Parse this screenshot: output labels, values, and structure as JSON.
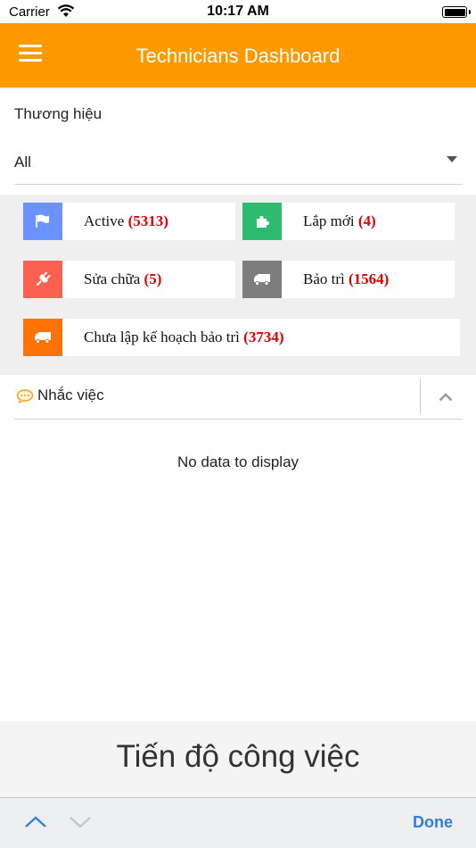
{
  "status_bar": {
    "carrier": "Carrier",
    "time": "10:17 AM",
    "battery_level": 1.0
  },
  "nav": {
    "title": "Technicians Dashboard",
    "menu_icon": "hamburger-menu-icon"
  },
  "filter": {
    "label": "Thương hiệu",
    "value": "All"
  },
  "tiles": [
    {
      "label": "Active",
      "count": "(5313)",
      "icon": "flag-icon",
      "color": "#6b93ff"
    },
    {
      "label": "Lắp mới",
      "count": "(4)",
      "icon": "puzzle-icon",
      "color": "#2fbb6f"
    },
    {
      "label": "Sửa chữa",
      "count": "(5)",
      "icon": "plug-icon",
      "color": "#fa6150"
    },
    {
      "label": "Bảo trì",
      "count": "(1564)",
      "icon": "truck-icon",
      "color": "#7d7d7d"
    },
    {
      "label": "Chưa lập kế hoạch bảo trì",
      "count": "(3734)",
      "icon": "truck-icon",
      "color": "#ff7306"
    }
  ],
  "reminder": {
    "title": "Nhắc việc",
    "icon": "chat-bubble-icon",
    "empty_text": "No data to display"
  },
  "picker": {
    "selected": "Tiến độ công việc"
  },
  "accessory": {
    "done_label": "Done"
  },
  "colors": {
    "accent": "#ff9900",
    "count": "#dd0000",
    "done": "#2f7dde"
  }
}
